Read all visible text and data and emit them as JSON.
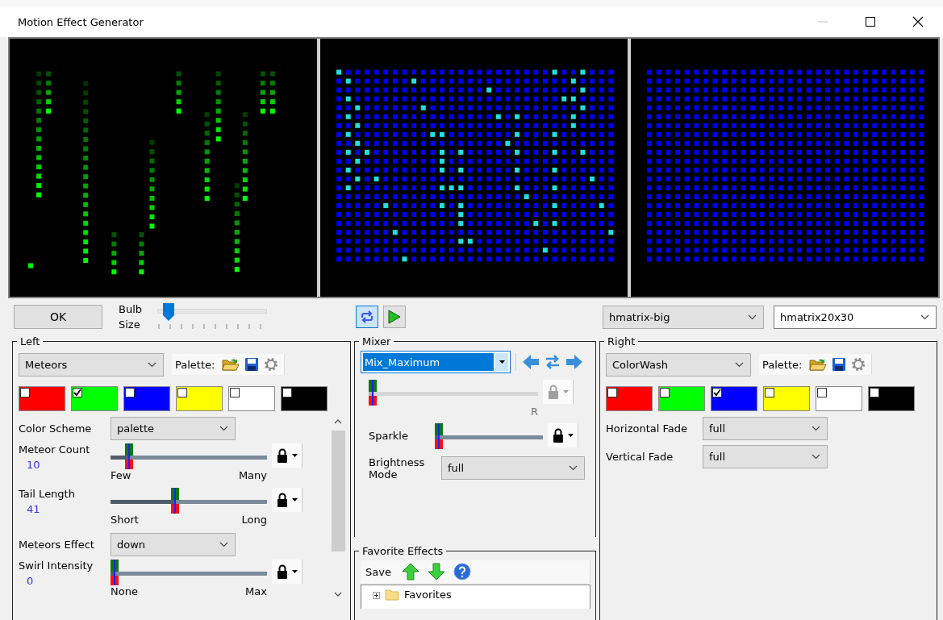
{
  "window": {
    "title": "Motion Effect Generator"
  },
  "toolbar": {
    "ok": "OK",
    "bulb_size": {
      "label": "Bulb Size",
      "level": 0.06
    },
    "loop_selected": true,
    "model": "hmatrix-big",
    "submodel": "hmatrix20x30"
  },
  "left": {
    "legend": "Left",
    "effect": "Meteors",
    "palette_label": "Palette:",
    "swatches": [
      {
        "color": "#ff0000",
        "checked": false
      },
      {
        "color": "#00ff00",
        "checked": true
      },
      {
        "color": "#0000ff",
        "checked": false
      },
      {
        "color": "#ffff00",
        "checked": false
      },
      {
        "color": "#ffffff",
        "checked": false
      },
      {
        "color": "#000000",
        "checked": false
      }
    ],
    "settings": [
      {
        "kind": "select",
        "label": "Color Scheme",
        "value": "palette"
      },
      {
        "kind": "slider",
        "label": "Meteor Count",
        "reading": "10",
        "min_label": "Few",
        "max_label": "Many",
        "level": 0.1
      },
      {
        "kind": "slider",
        "label": "Tail Length",
        "reading": "41",
        "min_label": "Short",
        "max_label": "Long",
        "level": 0.41
      },
      {
        "kind": "select",
        "label": "Meteors Effect",
        "value": "down"
      },
      {
        "kind": "slider",
        "label": "Swirl Intensity",
        "reading": "0",
        "min_label": "None",
        "max_label": "Max",
        "level": 0
      }
    ]
  },
  "mixer": {
    "legend": "Mixer",
    "method": "Mix_Maximum",
    "fade": {
      "end_label": "R",
      "level": 0,
      "lock_disabled": true
    },
    "sparkle": {
      "label": "Sparkle",
      "level": 0
    },
    "brightness": {
      "label": "Brightness Mode",
      "value": "full"
    }
  },
  "favorites": {
    "legend": "Favorite Effects",
    "save": "Save",
    "tree": [
      {
        "label": "Favorites",
        "expanded": false
      }
    ]
  },
  "right": {
    "legend": "Right",
    "effect": "ColorWash",
    "palette_label": "Palette:",
    "swatches": [
      {
        "color": "#ff0000",
        "checked": false
      },
      {
        "color": "#00ff00",
        "checked": false
      },
      {
        "color": "#0000ff",
        "checked": true
      },
      {
        "color": "#ffff00",
        "checked": false
      },
      {
        "color": "#ffffff",
        "checked": false
      },
      {
        "color": "#000000",
        "checked": false
      }
    ],
    "settings": [
      {
        "kind": "select",
        "label": "Horizontal Fade",
        "value": "full"
      },
      {
        "kind": "select",
        "label": "Vertical Fade",
        "value": "full"
      }
    ]
  }
}
